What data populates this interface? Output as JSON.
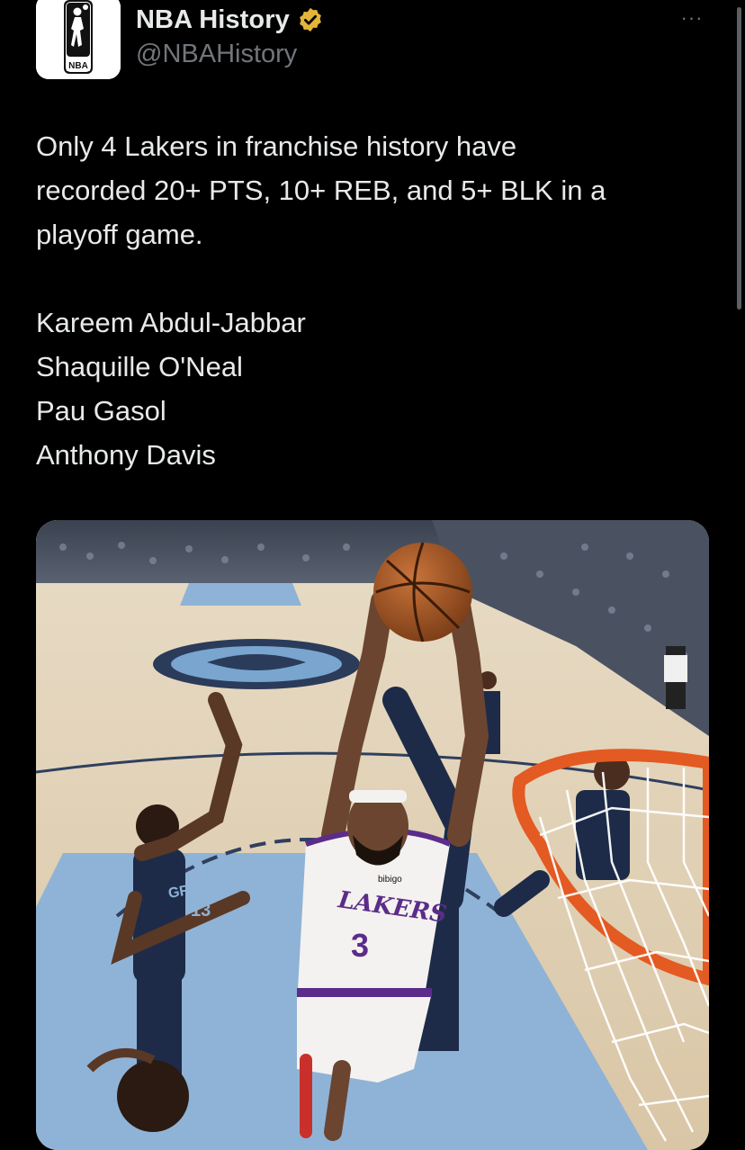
{
  "tweet": {
    "author": {
      "display_name": "NBA History",
      "handle": "@NBAHistory",
      "avatar_icon": "nba-logo-icon",
      "verified_icon": "verified-badge-icon",
      "verified_color": "#e3b43a"
    },
    "more_label": "···",
    "text": {
      "line1": "Only 4 Lakers in franchise history have",
      "line2": "recorded 20+ PTS, 10+ REB, and 5+ BLK in a",
      "line3": "playoff game.",
      "players": [
        "Kareem Abdul-Jabbar",
        "Shaquille O'Neal",
        "Pau Gasol",
        "Anthony Davis"
      ]
    },
    "media": {
      "jersey_team": "LAKERS",
      "jersey_number": "3",
      "opponent_jersey": "GRIZZLIES",
      "opponent_number": "13",
      "headband_brand": "bibigo"
    }
  },
  "colors": {
    "background": "#000000",
    "text_primary": "#e7e9ea",
    "text_secondary": "#71767b"
  }
}
